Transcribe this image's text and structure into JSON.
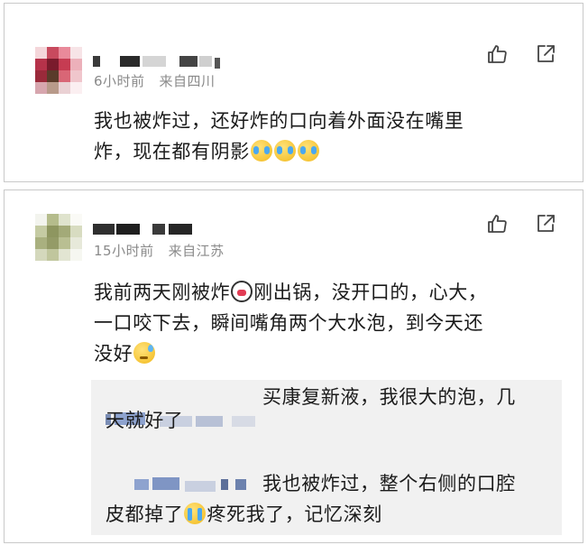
{
  "comments": [
    {
      "time": "6小时前",
      "location": "来自四川",
      "text_line1": "我也被炸过，还好炸的口向着外面没在嘴里",
      "text_line2": "炸，现在都有阴影",
      "emojis": [
        "crying-laughing-emoji",
        "crying-laughing-emoji",
        "crying-laughing-emoji"
      ],
      "actions": [
        "like-icon",
        "share-icon"
      ]
    },
    {
      "time": "15小时前",
      "location": "来自江苏",
      "text_line1_a": "我前两天刚被炸",
      "text_line1_b": "刚出锅，没开口的，心大，",
      "text_line2": "一口咬下去，瞬间嘴角两个大水泡，到今天还",
      "text_line3": "没好",
      "emojis": [
        "shocked-emoji",
        "sweat-emoji"
      ],
      "actions": [
        "like-icon",
        "share-icon"
      ],
      "replies": [
        {
          "text_line1": "买康复新液，我很大的泡，几",
          "text_line2": "天就好了"
        },
        {
          "text_line1": "我也被炸过，整个右侧的口腔",
          "text_line2_a": "皮都掉了",
          "text_line2_b": "疼死我了，记忆深刻",
          "emoji": "sobbing-emoji"
        }
      ]
    }
  ],
  "colors": {
    "meta": "#8a8a8a",
    "text": "#1b1b1b",
    "reply_bg": "#f1f1f1",
    "border": "#c9c9c9"
  }
}
